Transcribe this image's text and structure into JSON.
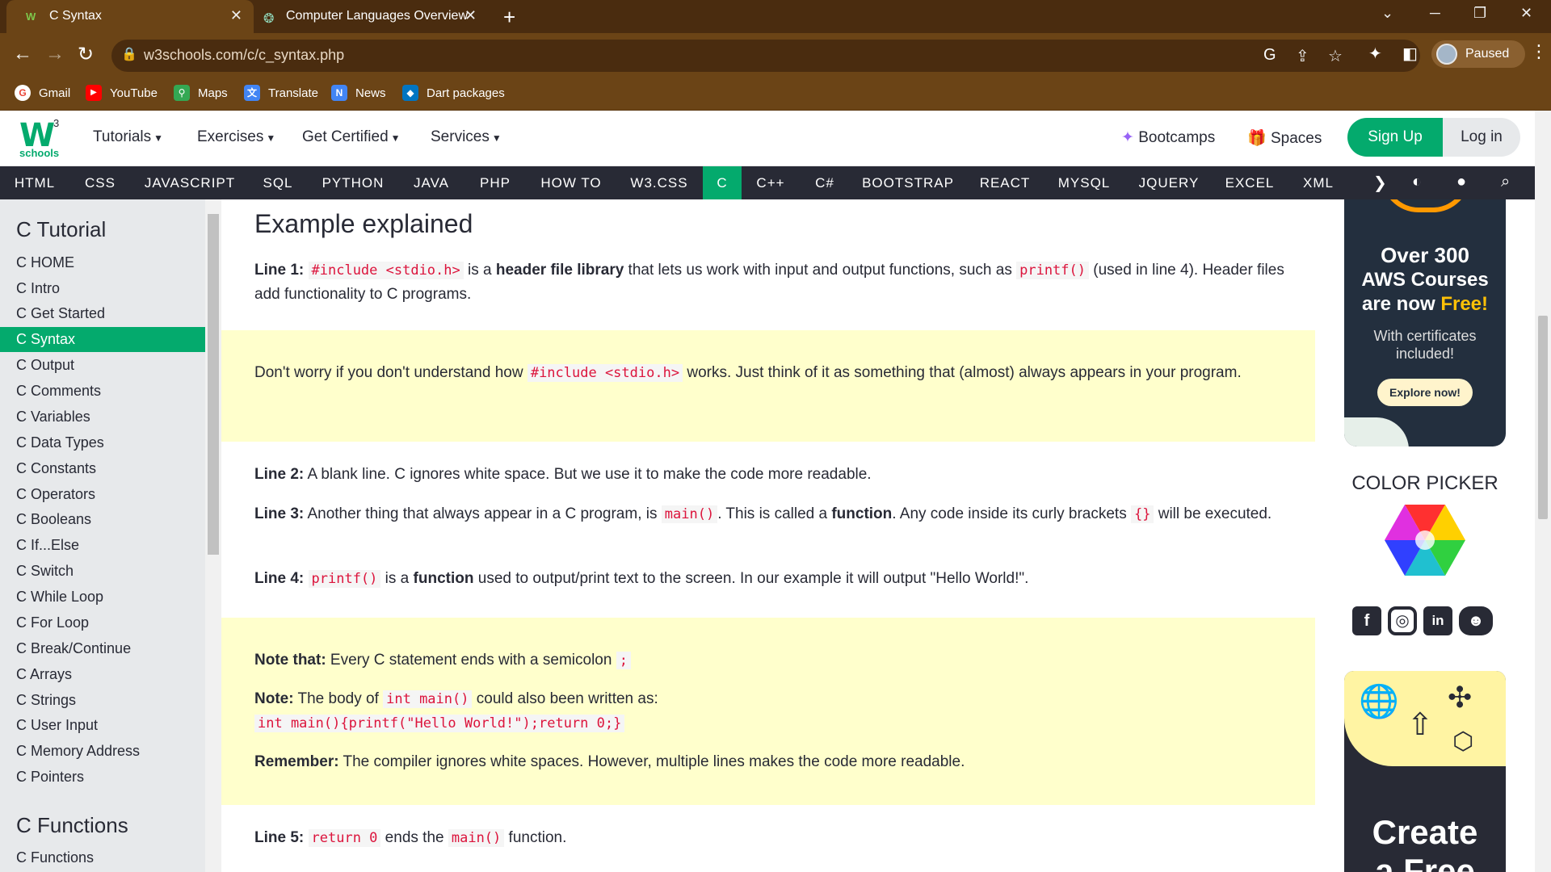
{
  "browser": {
    "tabs": [
      {
        "title": "C Syntax",
        "icon": "w3schools-favicon",
        "active": true
      },
      {
        "title": "Computer Languages Overview",
        "icon": "openai-favicon",
        "active": false
      }
    ],
    "url_domain": "w3schools.com",
    "url_path": "/c/c_syntax.php",
    "profile_label": "Paused",
    "bookmarks": [
      {
        "label": "Gmail",
        "icon": "google-icon",
        "color": "#ea4335"
      },
      {
        "label": "YouTube",
        "icon": "youtube-icon",
        "color": "#ff0000"
      },
      {
        "label": "Maps",
        "icon": "maps-icon",
        "color": "#34a853"
      },
      {
        "label": "Translate",
        "icon": "translate-icon",
        "color": "#4285f4"
      },
      {
        "label": "News",
        "icon": "news-icon",
        "color": "#4285f4"
      },
      {
        "label": "Dart packages",
        "icon": "dart-icon",
        "color": "#0175c2"
      }
    ]
  },
  "site": {
    "logo_sup": "3",
    "logo_sub": "schools",
    "menus": [
      "Tutorials",
      "Exercises",
      "Get Certified",
      "Services"
    ],
    "bootcamps": "Bootcamps",
    "spaces": "Spaces",
    "signup": "Sign Up",
    "login": "Log in",
    "topics": [
      "HTML",
      "CSS",
      "JAVASCRIPT",
      "SQL",
      "PYTHON",
      "JAVA",
      "PHP",
      "HOW TO",
      "W3.CSS",
      "C",
      "C++",
      "C#",
      "BOOTSTRAP",
      "REACT",
      "MYSQL",
      "JQUERY",
      "EXCEL",
      "XML"
    ],
    "active_topic": "C",
    "accent_color": "#04aa6d"
  },
  "sidebar": {
    "heading1": "C Tutorial",
    "items": [
      "C HOME",
      "C Intro",
      "C Get Started",
      "C Syntax",
      "C Output",
      "C Comments",
      "C Variables",
      "C Data Types",
      "C Constants",
      "C Operators",
      "C Booleans",
      "C If...Else",
      "C Switch",
      "C While Loop",
      "C For Loop",
      "C Break/Continue",
      "C Arrays",
      "C Strings",
      "C User Input",
      "C Memory Address",
      "C Pointers"
    ],
    "active_item": "C Syntax",
    "heading2": "C Functions",
    "items2": [
      "C Functions"
    ]
  },
  "content": {
    "heading": "Example explained",
    "line1": {
      "label": "Line 1:",
      "code": "#include <stdio.h>",
      "t1": " is a ",
      "bold": "header file library",
      "t2": " that lets us work with input and output functions, such as ",
      "code2": "printf()",
      "t3": " (used in line 4). Header files add functionality to C programs."
    },
    "note1": {
      "t1": "Don't worry if you don't understand how ",
      "code": "#include <stdio.h>",
      "t2": " works. Just think of it as something that (almost) always appears in your program."
    },
    "line2": {
      "label": "Line 2:",
      "text": " A blank line. C ignores white space. But we use it to make the code more readable."
    },
    "line3": {
      "label": "Line 3:",
      "t1": " Another thing that always appear in a C program, is ",
      "code": "main()",
      "t2": ". This is called a ",
      "bold": "function",
      "t3": ". Any code inside its curly brackets ",
      "code2": "{}",
      "t4": " will be executed."
    },
    "line4": {
      "label": "Line 4:",
      "code": "printf()",
      "t1": " is a ",
      "bold": "function",
      "t2": " used to output/print text to the screen. In our example it will output \"Hello World!\"."
    },
    "note2": {
      "label": "Note that:",
      "text": " Every C statement ends with a semicolon ",
      "code": ";"
    },
    "note3": {
      "label": "Note:",
      "t1": " The body of ",
      "code": "int main()",
      "t2": " could also been written as:",
      "code_line": "int main(){printf(\"Hello World!\");return 0;}"
    },
    "note4": {
      "label": "Remember:",
      "text": " The compiler ignores white spaces. However, multiple lines makes the code more readable."
    },
    "line5": {
      "label": "Line 5:",
      "code": "return 0",
      "t1": " ends the ",
      "code2": "main()",
      "t2": " function."
    }
  },
  "right": {
    "aws_line1": "Over 300",
    "aws_line2": "AWS Courses",
    "aws_line3a": "are now ",
    "aws_line3b": "Free!",
    "aws_sub": "With certificates included!",
    "aws_button": "Explore now!",
    "color_picker": "COLOR PICKER",
    "ad_create": "Create",
    "ad_free": "a Free"
  }
}
